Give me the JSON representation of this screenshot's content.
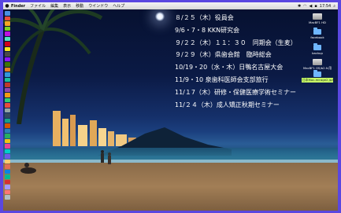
{
  "menubar": {
    "apple": "",
    "items": [
      "Finder",
      "ファイル",
      "編集",
      "表示",
      "移動",
      "ウインドウ",
      "ヘルプ"
    ],
    "clock": "17:54",
    "status_icons": [
      "bluetooth-icon",
      "wifi-icon",
      "volume-icon",
      "flag-icon",
      "search-icon"
    ]
  },
  "schedule": [
    "８/２５（木）役員会",
    "9/6・7・8 KKN研究会",
    "９/２２（木）１１：３０　同期会（生麦）",
    "９/２９（木）県歯会館　臨時総会",
    "10/19・20（水・木）日鴨名古屋大会",
    "11/9・10 泉歯科医師会支部旅行",
    "11/１7（木）研修・保健医療学術セミナー",
    "11/２４（木）成人矯正秋期セミナー"
  ],
  "desktop_icons": [
    {
      "label": "MacBF1 HD",
      "type": "drive"
    },
    {
      "label": "facebook",
      "type": "folder"
    },
    {
      "label": "backup",
      "type": "folder"
    },
    {
      "label": "MacBF1 OS/b2.fc用",
      "type": "drive"
    },
    {
      "label": "日本Mac-mirage2.jp/bkk",
      "type": "folder"
    }
  ],
  "colors": {
    "frame": "#5a47e0",
    "schedule_text": "#ffffff",
    "highlight": "#c8ff66"
  }
}
